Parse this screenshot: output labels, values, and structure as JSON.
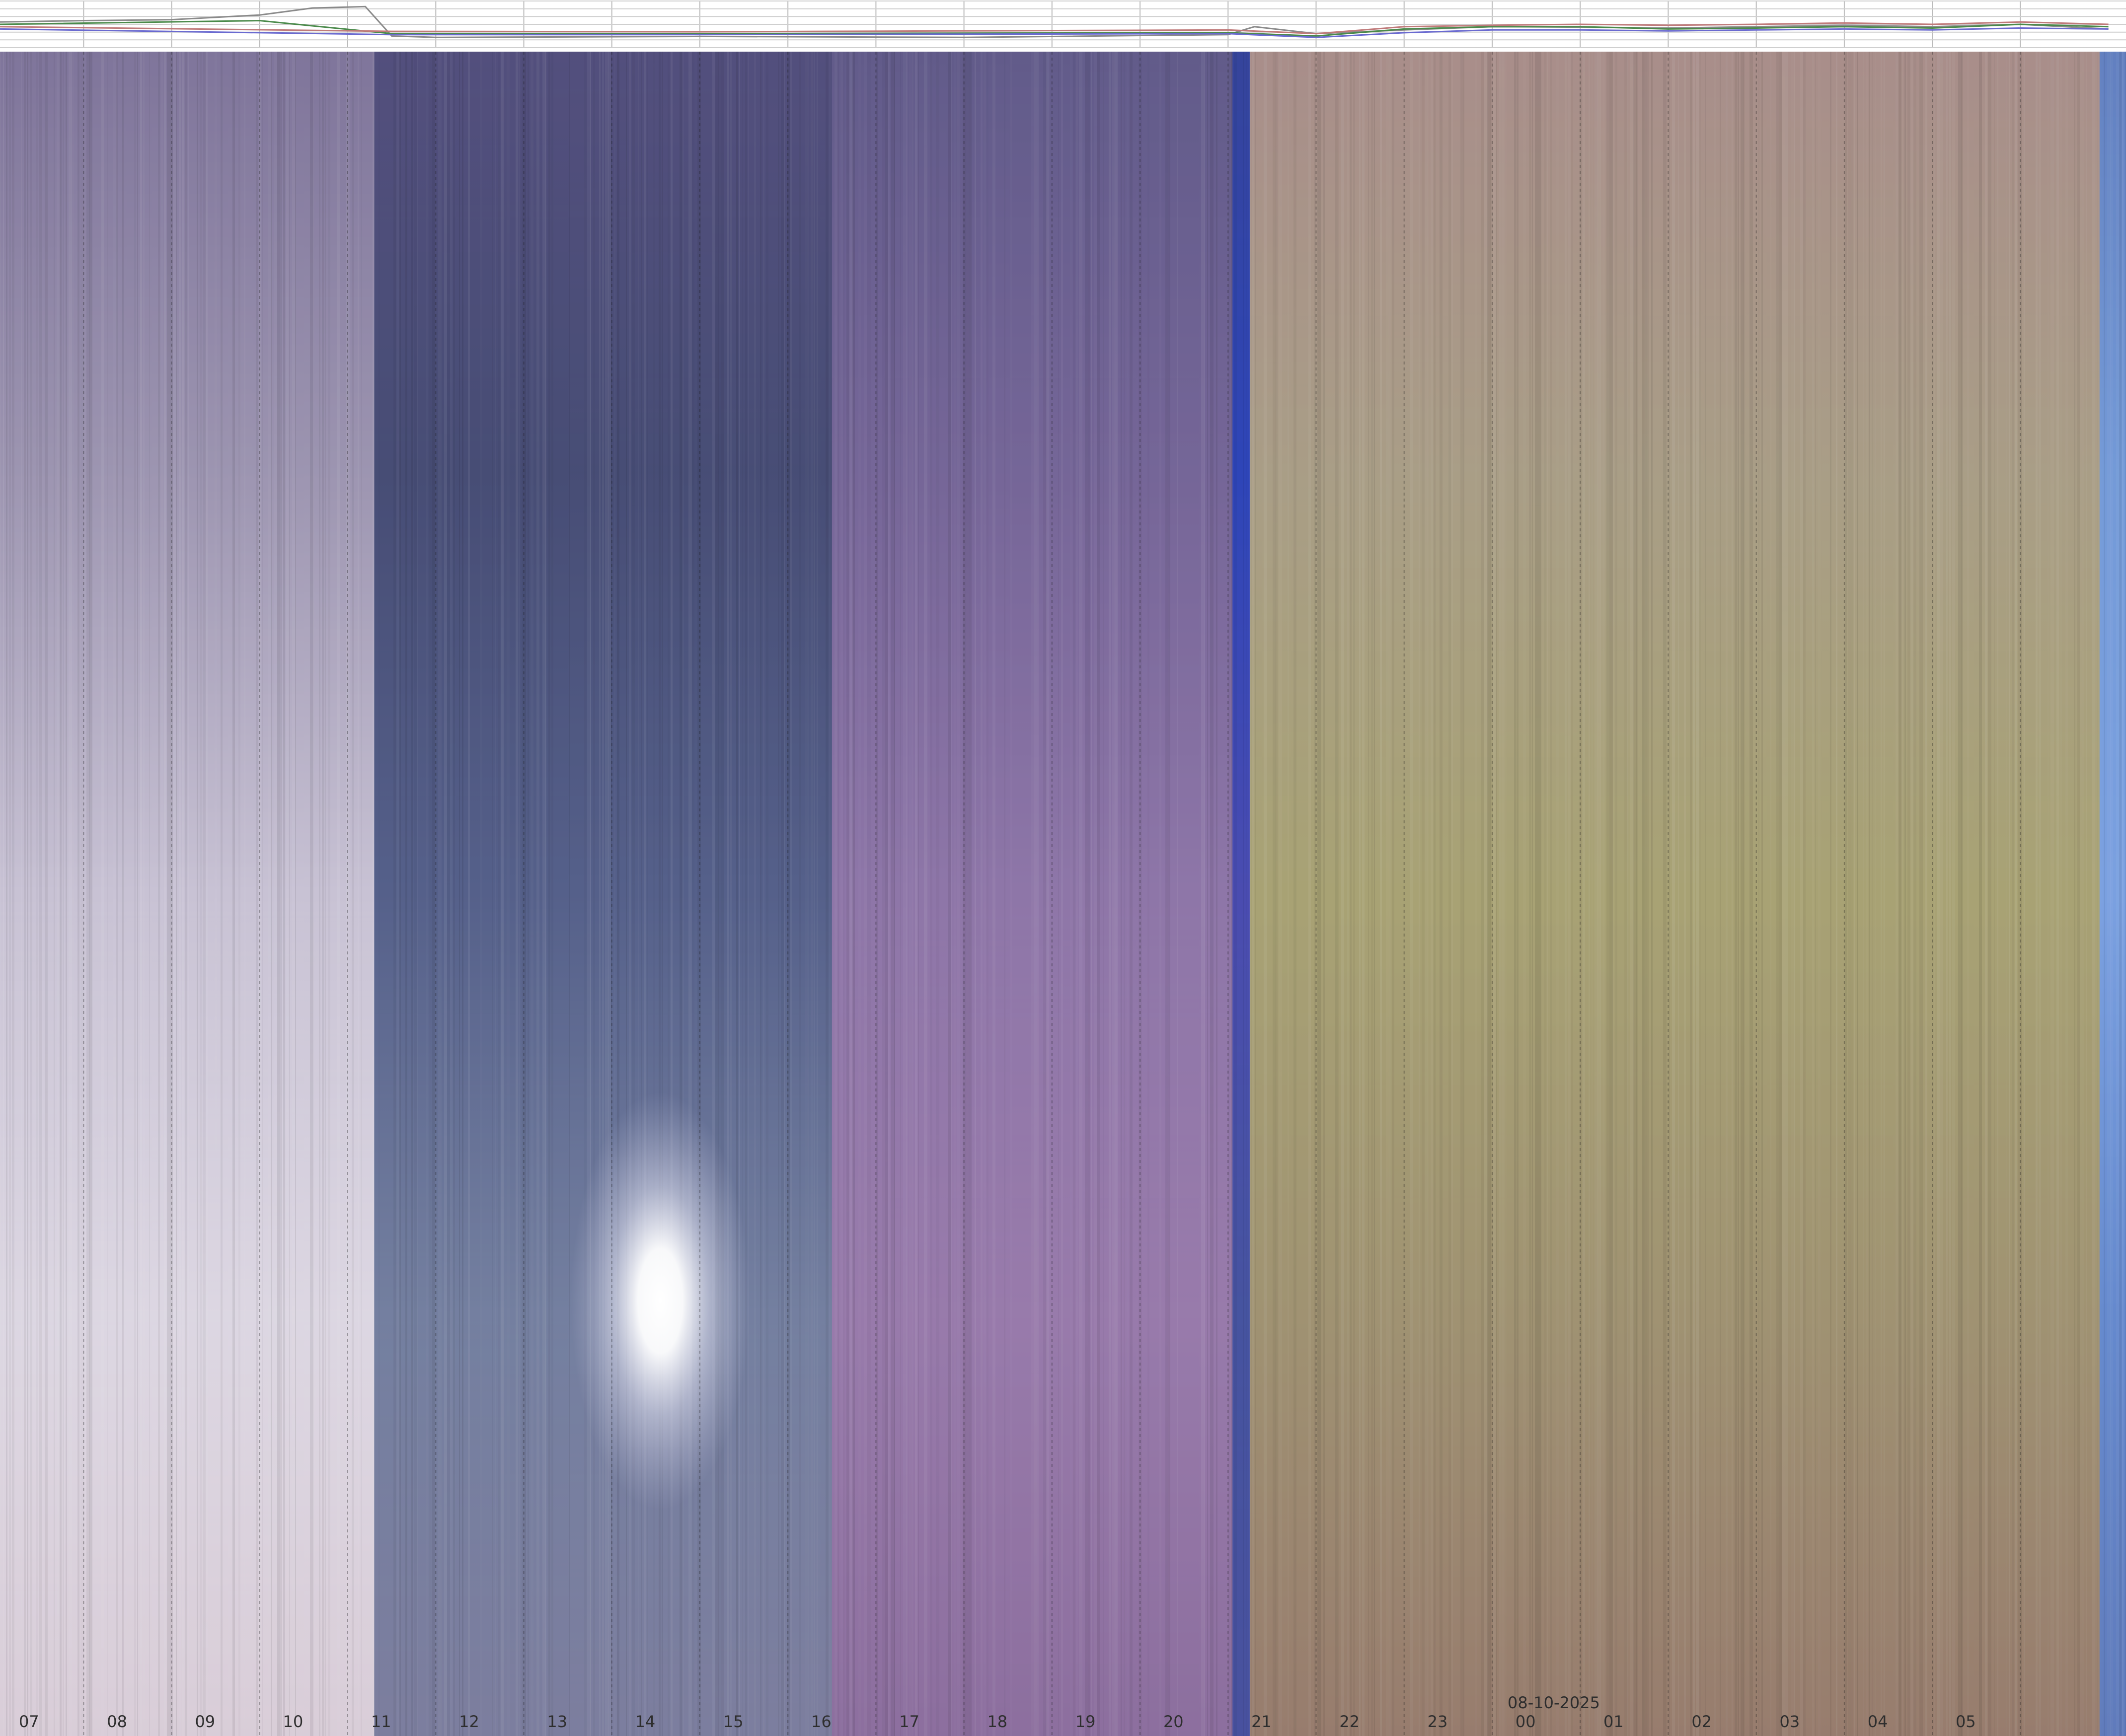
{
  "chart_data": {
    "type": "heatmap",
    "description_kind": "keogram",
    "date_label": "08-10-2025",
    "x_ticks": [
      {
        "label": "07",
        "hour": 7
      },
      {
        "label": "08",
        "hour": 8
      },
      {
        "label": "09",
        "hour": 9
      },
      {
        "label": "10",
        "hour": 10
      },
      {
        "label": "11",
        "hour": 11
      },
      {
        "label": "12",
        "hour": 12
      },
      {
        "label": "13",
        "hour": 13
      },
      {
        "label": "14",
        "hour": 14
      },
      {
        "label": "15",
        "hour": 15
      },
      {
        "label": "16",
        "hour": 16
      },
      {
        "label": "17",
        "hour": 17
      },
      {
        "label": "18",
        "hour": 18
      },
      {
        "label": "19",
        "hour": 19
      },
      {
        "label": "20",
        "hour": 20
      },
      {
        "label": "21",
        "hour": 21
      },
      {
        "label": "22",
        "hour": 22
      },
      {
        "label": "23",
        "hour": 23
      },
      {
        "label": "00",
        "hour": 24
      },
      {
        "label": "01",
        "hour": 25
      },
      {
        "label": "02",
        "hour": 26
      },
      {
        "label": "03",
        "hour": 27
      },
      {
        "label": "04",
        "hour": 28
      },
      {
        "label": "05",
        "hour": 29
      }
    ],
    "date_label_hour": 23.7,
    "hour_segments": [
      {
        "start": 6.05,
        "end": 10.3,
        "colors": [
          "#8a7fa8",
          "#a39bb8",
          "#c8c2d4",
          "#e8e2ee",
          "#f1e4f0"
        ]
      },
      {
        "start": 10.3,
        "end": 15.5,
        "colors": [
          "#5a5688",
          "#4a507a",
          "#55608a",
          "#7a86a8",
          "#8a8cb0"
        ]
      },
      {
        "start": 15.5,
        "end": 20.05,
        "colors": [
          "#6a6396",
          "#7a6a9e",
          "#8e76a8",
          "#a081b4",
          "#9c7bb0"
        ]
      },
      {
        "start": 20.05,
        "end": 20.25,
        "colors": [
          "#3a4aa8",
          "#3048c0",
          "#4a4cb0",
          "#4a58a8",
          "#505ab0"
        ]
      },
      {
        "start": 20.25,
        "end": 29.9,
        "colors": [
          "#b79a96",
          "#b0a48c",
          "#a8a274",
          "#a89a78",
          "#a88a7a"
        ]
      },
      {
        "start": 29.9,
        "end": 30.2,
        "colors": [
          "#6a8ad0",
          "#78a0e0",
          "#7aa0e0",
          "#6a90d8",
          "#6a88d0"
        ]
      }
    ],
    "sun_glare": {
      "hour": 13.55
    },
    "sensor_series": [
      {
        "color": "#8a8a8a",
        "points": [
          [
            6.05,
            0.45
          ],
          [
            7.0,
            0.42
          ],
          [
            8.0,
            0.4
          ],
          [
            9.0,
            0.3
          ],
          [
            9.6,
            0.15
          ],
          [
            10.2,
            0.12
          ],
          [
            10.5,
            0.75
          ],
          [
            11.0,
            0.78
          ],
          [
            14.0,
            0.76
          ],
          [
            17.0,
            0.78
          ],
          [
            20.0,
            0.72
          ],
          [
            20.3,
            0.55
          ],
          [
            21.0,
            0.7
          ],
          [
            22.0,
            0.62
          ],
          [
            23.0,
            0.55
          ],
          [
            24.0,
            0.56
          ],
          [
            25.0,
            0.58
          ],
          [
            26.0,
            0.55
          ],
          [
            27.0,
            0.52
          ],
          [
            28.0,
            0.55
          ],
          [
            29.0,
            0.5
          ],
          [
            30.0,
            0.6
          ]
        ]
      },
      {
        "color": "#4a8a4a",
        "points": [
          [
            6.05,
            0.5
          ],
          [
            9.0,
            0.42
          ],
          [
            10.5,
            0.7
          ],
          [
            14.0,
            0.7
          ],
          [
            20.0,
            0.68
          ],
          [
            21.0,
            0.75
          ],
          [
            22.0,
            0.6
          ],
          [
            23.0,
            0.55
          ],
          [
            24.0,
            0.55
          ],
          [
            25.0,
            0.6
          ],
          [
            26.0,
            0.58
          ],
          [
            27.0,
            0.55
          ],
          [
            28.0,
            0.58
          ],
          [
            29.0,
            0.5
          ],
          [
            30.0,
            0.55
          ]
        ]
      },
      {
        "color": "#c07a7a",
        "points": [
          [
            6.05,
            0.55
          ],
          [
            10.5,
            0.65
          ],
          [
            14.0,
            0.66
          ],
          [
            20.0,
            0.62
          ],
          [
            21.0,
            0.7
          ],
          [
            22.0,
            0.55
          ],
          [
            23.0,
            0.52
          ],
          [
            24.0,
            0.5
          ],
          [
            25.0,
            0.52
          ],
          [
            26.0,
            0.5
          ],
          [
            27.0,
            0.47
          ],
          [
            28.0,
            0.5
          ],
          [
            29.0,
            0.45
          ],
          [
            30.0,
            0.5
          ]
        ]
      },
      {
        "color": "#6a6ad0",
        "points": [
          [
            6.05,
            0.6
          ],
          [
            10.5,
            0.72
          ],
          [
            14.0,
            0.72
          ],
          [
            20.0,
            0.7
          ],
          [
            21.0,
            0.78
          ],
          [
            22.0,
            0.68
          ],
          [
            23.0,
            0.62
          ],
          [
            24.0,
            0.62
          ],
          [
            25.0,
            0.64
          ],
          [
            26.0,
            0.62
          ],
          [
            27.0,
            0.6
          ],
          [
            28.0,
            0.62
          ],
          [
            29.0,
            0.58
          ],
          [
            30.0,
            0.6
          ]
        ]
      }
    ],
    "x_range_hours": [
      6.05,
      30.2
    ]
  }
}
